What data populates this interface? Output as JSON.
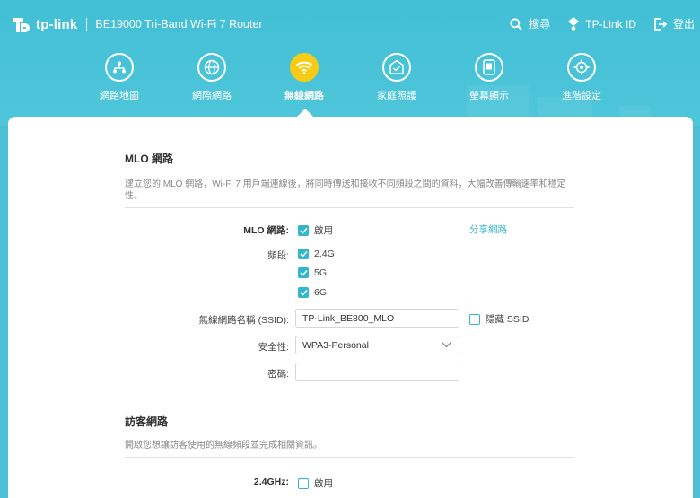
{
  "brand": {
    "logo_text": "tp-link",
    "model": "BE19000 Tri-Band Wi-Fi 7 Router"
  },
  "top_actions": {
    "search": "搜尋",
    "account": "TP-Link ID",
    "logout": "登出"
  },
  "nav": [
    {
      "label": "網路地圖",
      "icon": "network-map-icon"
    },
    {
      "label": "網際網路",
      "icon": "globe-icon"
    },
    {
      "label": "無線網路",
      "icon": "wifi-icon",
      "active": true
    },
    {
      "label": "家庭照護",
      "icon": "home-shield-icon"
    },
    {
      "label": "螢幕顯示",
      "icon": "screen-icon"
    },
    {
      "label": "進階設定",
      "icon": "gear-icon"
    }
  ],
  "mlo": {
    "title": "MLO 網路",
    "description": "建立您的 MLO 網路，Wi-Fi 7 用戶端連線後，將同時傳送和接收不同頻段之間的資料，大幅改善傳輸速率和穩定性。",
    "network_label": "MLO 網路:",
    "enable_text": "啟用",
    "enabled": true,
    "share_link": "分享網路",
    "band_label": "頻段:",
    "bands": [
      {
        "text": "2.4G",
        "checked": true
      },
      {
        "text": "5G",
        "checked": true
      },
      {
        "text": "6G",
        "checked": true
      }
    ],
    "ssid_label": "無線網路名稱 (SSID):",
    "ssid_value": "TP-Link_BE800_MLO",
    "hide_ssid_text": "隱藏 SSID",
    "hide_ssid": false,
    "security_label": "安全性:",
    "security_value": "WPA3-Personal",
    "password_label": "密碼:",
    "password_value": ""
  },
  "guest": {
    "title": "訪客網路",
    "description": "開啟您想讓訪客使用的無線頻段並完成相關資訊。",
    "band_24_label": "2.4GHz:",
    "enable_text": "啟用",
    "enabled": false
  },
  "colors": {
    "header": "#42bfd6",
    "accent": "#33b5cb",
    "active_nav": "#f7cc14"
  }
}
